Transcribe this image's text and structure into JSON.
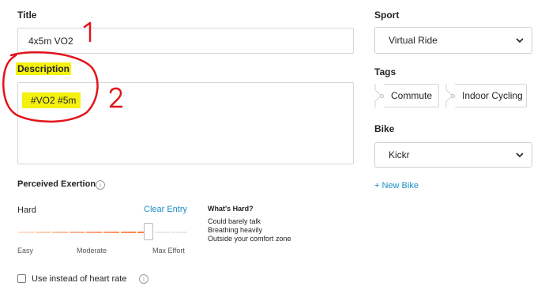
{
  "title": {
    "label": "Title",
    "value": "4x5m VO2",
    "annotation": "1"
  },
  "description": {
    "label": "Description",
    "value": "#VO2 #5m",
    "annotation": "2"
  },
  "sport": {
    "label": "Sport",
    "value": "Virtual Ride",
    "icon": "chevron-down-icon"
  },
  "tags": {
    "label": "Tags",
    "items": [
      "Commute",
      "Indoor Cycling"
    ]
  },
  "bike": {
    "label": "Bike",
    "value": "Kickr",
    "new_bike": "+ New Bike",
    "icon": "chevron-down-icon"
  },
  "exertion": {
    "label": "Perceived Exertion",
    "level": "Hard",
    "clear": "Clear Entry",
    "slider_fraction": 0.77,
    "scale": [
      "Easy",
      "Moderate",
      "Max Effort"
    ],
    "whats_hard_title": "What's Hard?",
    "whats_hard_lines": [
      "Could barely talk",
      "Breathing heavily",
      "Outside your comfort zone"
    ]
  },
  "heart_rate": {
    "label": "Use instead of heart rate",
    "checked": false
  },
  "colors": {
    "accent": "#fc5200",
    "link": "#1a8ec9",
    "highlight": "#f4f10f",
    "annotation": "#e3141b"
  }
}
